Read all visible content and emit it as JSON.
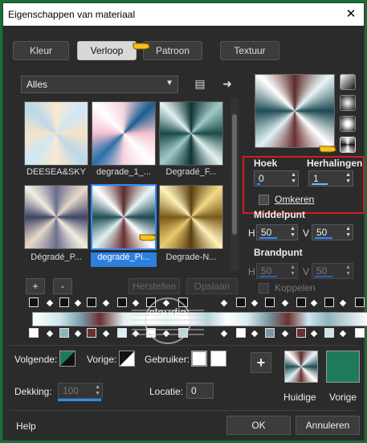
{
  "window": {
    "title": "Eigenschappen van materiaal",
    "close": "✕"
  },
  "tabs": [
    {
      "label": "Kleur"
    },
    {
      "label": "Verloop"
    },
    {
      "label": "Patroon"
    },
    {
      "label": "Textuur"
    }
  ],
  "gallery": {
    "filter_value": "Alles",
    "items": [
      {
        "label": "DEESEA&SKY"
      },
      {
        "label": "degrade_1_..."
      },
      {
        "label": "Degradé_F..."
      },
      {
        "label": "Dégradé_P..."
      },
      {
        "label": "degradé_Pi..."
      },
      {
        "label": "Degrade-N..."
      }
    ],
    "add": "+",
    "remove": "-",
    "restore": "Herstellen",
    "save": "Opslaan"
  },
  "gradient_settings": {
    "angle_label": "Hoek",
    "angle_value": "0",
    "repeats_label": "Herhalingen",
    "repeats_value": "1",
    "invert_label": "Omkeren",
    "midpoint_label": "Middelpunt",
    "mid_h_label": "H",
    "mid_h_value": "50",
    "mid_v_label": "V",
    "mid_v_value": "50",
    "focal_label": "Brandpunt",
    "focal_h_label": "H",
    "focal_h_value": "50",
    "focal_v_label": "V",
    "focal_v_value": "50",
    "link_label": "Koppelen"
  },
  "stops": {
    "next_label": "Volgende:",
    "prev_label": "Vorige:",
    "user_label": "Gebruiker:",
    "opacity_label": "Dekking:",
    "opacity_value": "100",
    "location_label": "Locatie:",
    "location_value": "0",
    "plus": "+"
  },
  "swatches": {
    "current_label": "Huidige",
    "previous_label": "Vorige",
    "previous_color": "#1f7a5c"
  },
  "footer": {
    "help": "Help",
    "ok": "OK",
    "cancel": "Annuleren"
  },
  "watermark": "claudia"
}
